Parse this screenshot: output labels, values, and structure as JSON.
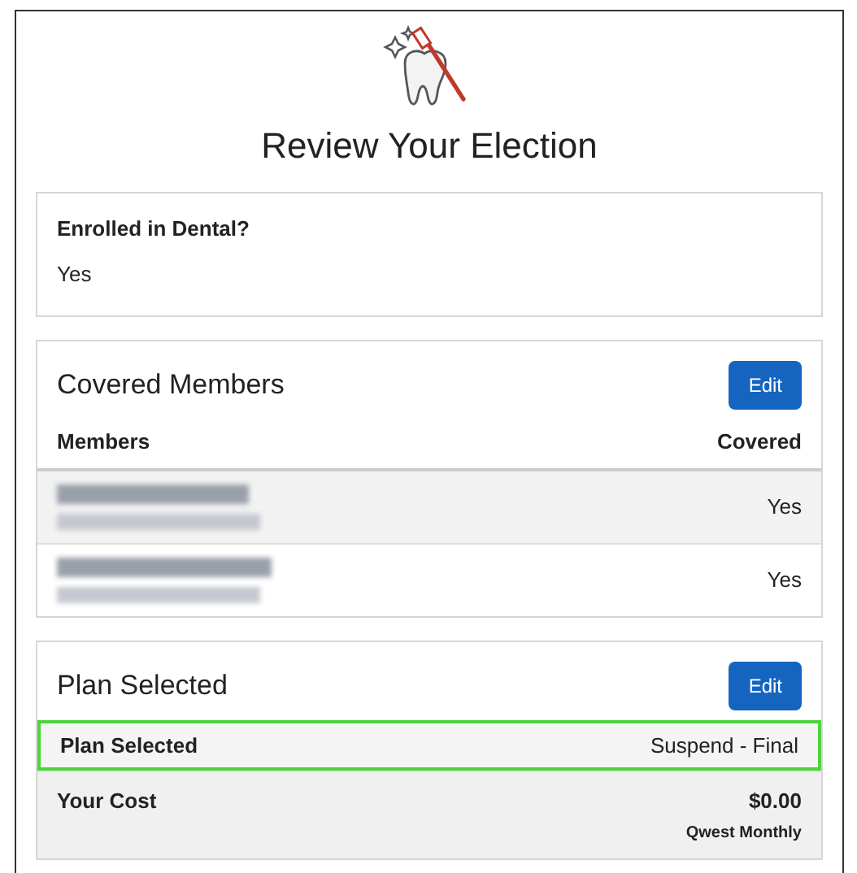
{
  "title": "Review Your Election",
  "enrollment": {
    "label": "Enrolled in Dental?",
    "value": "Yes"
  },
  "covered_members": {
    "title": "Covered Members",
    "edit_button": "Edit",
    "columns": [
      "Members",
      "Covered"
    ],
    "rows": [
      {
        "covered": "Yes"
      },
      {
        "covered": "Yes"
      }
    ]
  },
  "plan": {
    "title": "Plan Selected",
    "edit_button": "Edit",
    "rows": [
      {
        "kind": "plan",
        "label": "Plan Selected",
        "value": "Suspend - Final",
        "highlighted": true
      },
      {
        "kind": "cost",
        "label": "Your Cost",
        "value": "$0.00",
        "note": "Qwest Monthly",
        "highlighted": false
      }
    ]
  }
}
